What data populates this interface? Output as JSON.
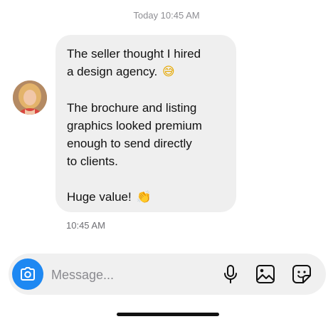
{
  "conversation": {
    "date_stamp": "Today 10:45 AM",
    "message": {
      "lines": [
        "The seller thought I hired",
        "a design agency.",
        "",
        "The brochure and listing",
        "graphics looked premium",
        "enough to send directly",
        "to clients.",
        "",
        "Huge value!"
      ],
      "emoji_1": "😅",
      "emoji_2": "👏"
    },
    "time_stamp": "10:45 AM"
  },
  "composer": {
    "placeholder": "Message...",
    "value": ""
  },
  "icons": {
    "camera": "camera-icon",
    "mic": "microphone-icon",
    "gallery": "image-icon",
    "sticker": "sticker-icon"
  },
  "colors": {
    "accent": "#1e88f2",
    "bubble": "#efefef",
    "composer": "#f0f0f0",
    "meta_text": "#8e8e93"
  }
}
